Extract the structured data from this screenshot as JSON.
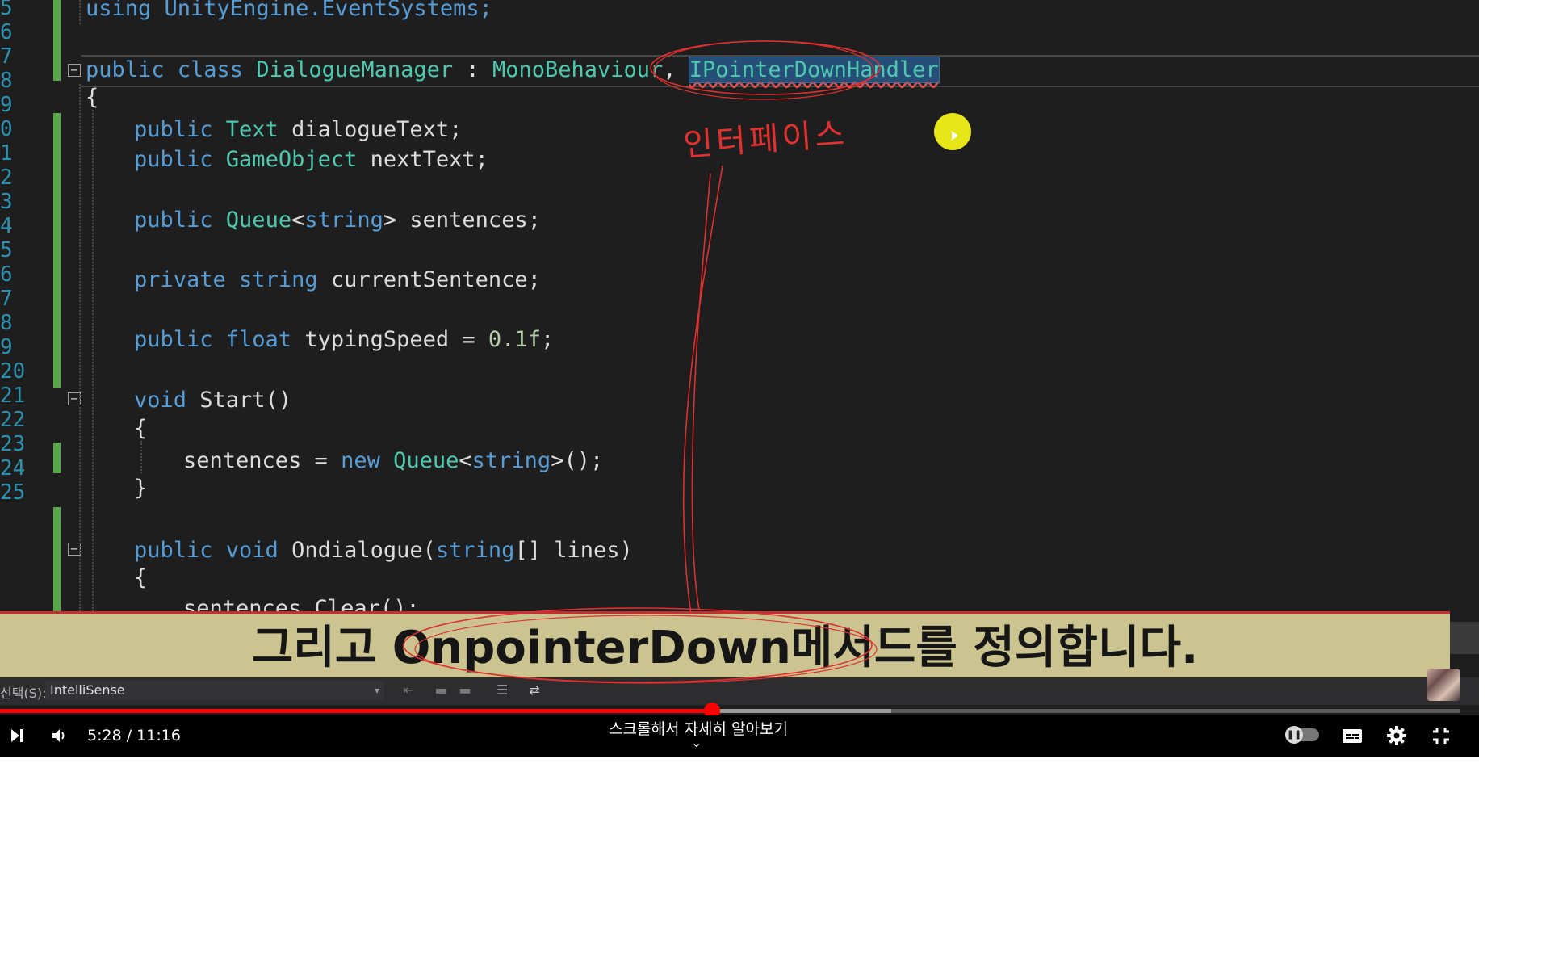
{
  "editor": {
    "line_numbers": [
      "5",
      "6",
      "7",
      "8",
      "9",
      "0",
      "1",
      "2",
      "3",
      "4",
      "5",
      "6",
      "7",
      "8",
      "9",
      "20",
      "21",
      "22",
      "23",
      "24",
      "25"
    ],
    "lines": {
      "l5": "using UnityEngine.EventSystems;",
      "l7_a": "public class ",
      "l7_b": "DialogueManager",
      "l7_c": " : ",
      "l7_d": "MonoBehaviour",
      "l7_e": ", ",
      "l7_f": "IPointerDownHandler",
      "l8": "{",
      "l9_a": "public ",
      "l9_b": "Text",
      "l9_c": " dialogueText;",
      "l10_a": "public ",
      "l10_b": "GameObject",
      "l10_c": " nextText;",
      "l12_a": "public ",
      "l12_b": "Queue",
      "l12_c": "<",
      "l12_d": "string",
      "l12_e": "> sentences;",
      "l14_a": "private string",
      "l14_b": " currentSentence;",
      "l16_a": "public float",
      "l16_b": " typingSpeed = ",
      "l16_c": "0.1f",
      "l16_d": ";",
      "l18_a": "void",
      "l18_b": " Start()",
      "l19": "{",
      "l20_a": "sentences = ",
      "l20_b": "new ",
      "l20_c": "Queue",
      "l20_d": "<",
      "l20_e": "string",
      "l20_f": ">();",
      "l21": "}",
      "l23_a": "public void",
      "l23_b": " Ondialogue(",
      "l23_c": "string",
      "l23_d": "[] lines)",
      "l24": "{",
      "l25": "sentences.Clear();"
    }
  },
  "annotation": {
    "handwritten_note": "인터페이스"
  },
  "subtitle": {
    "text": "그리고 OnpointerDown메서드를 정의합니다."
  },
  "vs_bar": {
    "select_label": "선택(S):",
    "select_value": "IntelliSense"
  },
  "player": {
    "time": "5:28 / 11:16",
    "chapter": "스크롤해서 자세히 알아보기",
    "played_fraction": 0.4877,
    "buffered_fraction": 0.6106,
    "icons": {
      "next": "skip-next-icon",
      "volume": "volume-icon",
      "autoplay": "autoplay-toggle-icon",
      "captions": "subtitles-icon",
      "settings": "gear-icon",
      "exit_fullscreen": "exit-fullscreen-icon"
    },
    "colors": {
      "progress": "#ff0000",
      "accent_yellow": "#e6e619",
      "ink": "#e03030"
    }
  }
}
